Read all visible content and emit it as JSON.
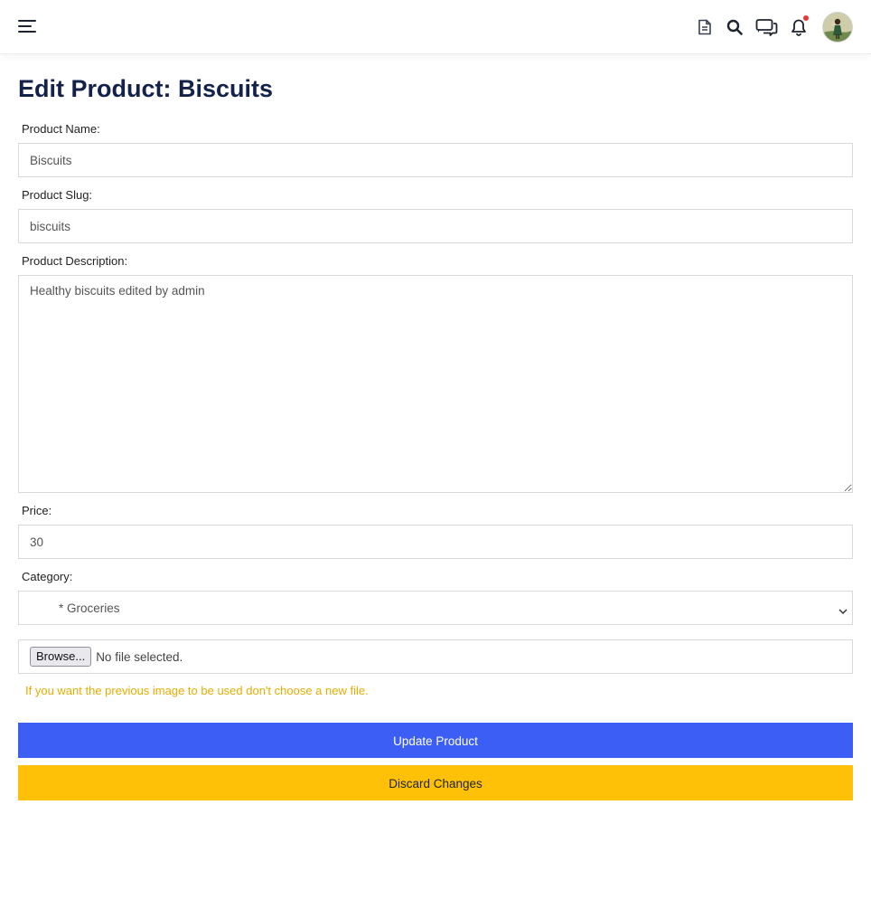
{
  "header": {
    "icons": [
      "menu-icon",
      "document-icon",
      "search-icon",
      "chat-icon",
      "bell-icon",
      "avatar"
    ],
    "has_notification": true
  },
  "page": {
    "title": "Edit Product: Biscuits"
  },
  "form": {
    "name_label": "Product Name:",
    "name_value": "Biscuits",
    "slug_label": "Product Slug:",
    "slug_value": "biscuits",
    "description_label": "Product Description:",
    "description_value": "Healthy biscuits edited by admin",
    "price_label": "Price:",
    "price_value": "30",
    "category_label": "Category:",
    "category_selected": "* Groceries",
    "file_button": "Browse...",
    "file_status": "No file selected.",
    "image_hint": "If you want the previous image to be used don't choose a new file.",
    "update_button": "Update Product",
    "discard_button": "Discard Changes"
  },
  "colors": {
    "title": "#14224a",
    "primary": "#3c5ef5",
    "warning": "#ffc107",
    "hint": "#e6ad00",
    "notification": "#e53935"
  }
}
